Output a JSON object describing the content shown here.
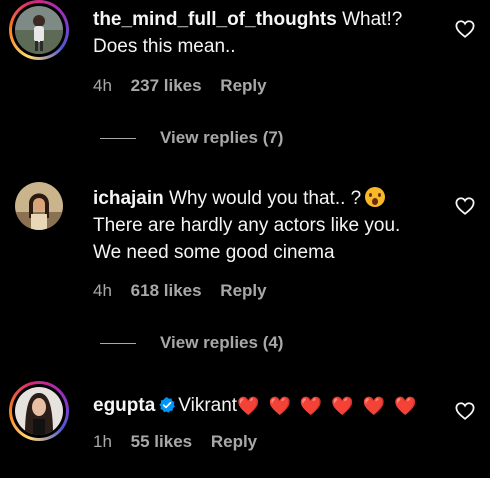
{
  "comments": [
    {
      "username": "the_mind_full_of_thoughts",
      "text_line1": "What!?",
      "text_line2": "Does this mean..",
      "time": "4h",
      "likes": "237 likes",
      "reply": "Reply",
      "view_replies": "View replies (7)",
      "story_ring": true
    },
    {
      "username": "ichajain",
      "text_line1": "Why would you that.. ?",
      "emoji": "astonished-face-emoji",
      "text_line2": "There are hardly any actors like you.",
      "text_line3": "We need some good cinema",
      "time": "4h",
      "likes": "618 likes",
      "reply": "Reply",
      "view_replies": "View replies (4)",
      "story_ring": false
    },
    {
      "username": "egupta",
      "verified": true,
      "text": "Vikrant",
      "hearts": "❤️ ❤️ ❤️ ❤️ ❤️ ❤️",
      "time": "1h",
      "likes": "55 likes",
      "reply": "Reply",
      "story_ring": true
    }
  ],
  "colors": {
    "background": "#000000",
    "primary_text": "#f5f5f5",
    "secondary_text": "#a8a8a8",
    "verified_blue": "#0095f6",
    "heart_red": "#e0245e"
  },
  "icons": {
    "like": "heart-outline-icon",
    "verified": "verified-badge-icon"
  }
}
